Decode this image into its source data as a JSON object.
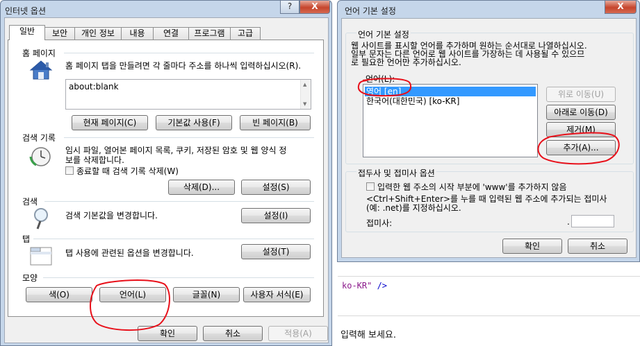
{
  "background": {
    "code_str": "ko-KR\"",
    "code_tag": " />",
    "text": "입력해 보세요."
  },
  "internet_options": {
    "title": "인터넷 옵션",
    "help_btn": "?",
    "close_btn": "X",
    "tabs": [
      "일반",
      "보안",
      "개인 정보",
      "내용",
      "연결",
      "프로그램",
      "고급"
    ],
    "home": {
      "section": "홈 페이지",
      "desc": "홈 페이지 탭을 만들려면 각 줄마다 주소를 하나씩 입력하십시오(R).",
      "value": "about:blank",
      "btn_current": "현재 페이지(C)",
      "btn_default": "기본값 사용(F)",
      "btn_blank": "빈 페이지(B)"
    },
    "history": {
      "section": "검색 기록",
      "desc_line1": "임시 파일, 열어본 페이지 목록, 쿠키, 저장된 암호 및 웹 양식 정",
      "desc_line2": "보를 삭제합니다.",
      "checkbox": "종료할 때 검색 기록 삭제(W)",
      "btn_delete": "삭제(D)...",
      "btn_settings": "설정(S)"
    },
    "search": {
      "section": "검색",
      "desc": "검색 기본값을 변경합니다.",
      "btn_settings": "설정(I)"
    },
    "tabs_section": {
      "section": "탭",
      "desc": "탭 사용에 관련된 옵션을 변경합니다.",
      "btn_settings": "설정(T)"
    },
    "appearance": {
      "section": "모양",
      "btn_colors": "색(O)",
      "btn_languages": "언어(L)",
      "btn_fonts": "글꼴(N)",
      "btn_accessibility": "사용자 서식(E)"
    },
    "footer": {
      "ok": "확인",
      "cancel": "취소",
      "apply": "적용(A)"
    }
  },
  "language_pref": {
    "title": "언어 기본 설정",
    "close_btn": "X",
    "group_title": "언어 기본 설정",
    "desc_line1": "웹 사이트를 표시할 언어를 추가하며 원하는 순서대로 나열하십시오.",
    "desc_line2": "일부 문자는 다른 언어로 웹 사이트를 가장하는 데 사용될 수 있으므",
    "desc_line3": "로 필요한 언어만 추가하십시오.",
    "list_label": "언어(L):",
    "languages": [
      "영어 [en]",
      "한국어(대한민국) [ko-KR]"
    ],
    "btn_up": "위로 이동(U)",
    "btn_down": "아래로 이동(D)",
    "btn_remove": "제거(M)",
    "btn_add": "추가(A)...",
    "suffix_group": "접두사 및 접미사 옵션",
    "checkbox": "입력한 웹 주소의 시작 부분에 'www'를 추가하지 않음",
    "hint_line1": "<Ctrl+Shift+Enter>를 누를 때 입력된 웹 주소에 추가되는 접미사",
    "hint_line2": "(예: .net)를 지정하십시오.",
    "suffix_label": "접미사:",
    "suffix_dot": ".",
    "suffix_value": "",
    "ok": "확인",
    "cancel": "취소"
  }
}
